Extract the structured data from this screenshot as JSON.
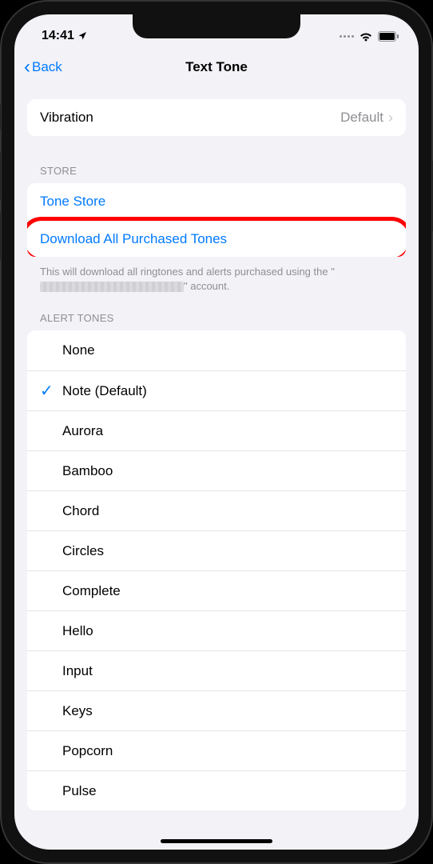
{
  "status": {
    "time": "14:41"
  },
  "nav": {
    "back_label": "Back",
    "title": "Text Tone"
  },
  "vibration": {
    "label": "Vibration",
    "value": "Default"
  },
  "store": {
    "header": "STORE",
    "tone_store": "Tone Store",
    "download_all": "Download All Purchased Tones",
    "footer_prefix": "This will download all ringtones and alerts purchased using the \"",
    "footer_suffix": "\" account."
  },
  "alert_tones": {
    "header": "ALERT TONES",
    "selected_index": 1,
    "items": [
      "None",
      "Note (Default)",
      "Aurora",
      "Bamboo",
      "Chord",
      "Circles",
      "Complete",
      "Hello",
      "Input",
      "Keys",
      "Popcorn",
      "Pulse"
    ]
  }
}
